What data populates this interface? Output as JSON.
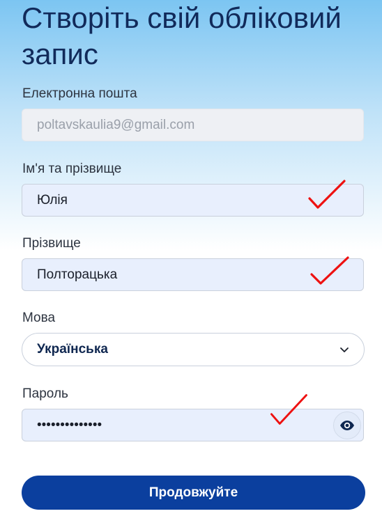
{
  "page": {
    "title": "Створіть свій обліковий запис"
  },
  "form": {
    "email": {
      "label": "Електронна пошта",
      "value": "poltavskaulia9@gmail.com"
    },
    "first_name": {
      "label": "Ім'я та прізвище",
      "value": "Юлія"
    },
    "last_name": {
      "label": "Прізвище",
      "value": "Полторацька"
    },
    "language": {
      "label": "Мова",
      "value": "Українська"
    },
    "password": {
      "label": "Пароль",
      "value": "••••••••••••••"
    }
  },
  "submit": {
    "label": "Продовжуйте"
  },
  "colors": {
    "primary": "#0b3f9e",
    "title": "#112a5a",
    "annotation": "#ee1111"
  },
  "icons": {
    "select": "chevron-down-icon",
    "password_toggle": "eye-icon",
    "annotation": "red-checkmark-icon"
  }
}
